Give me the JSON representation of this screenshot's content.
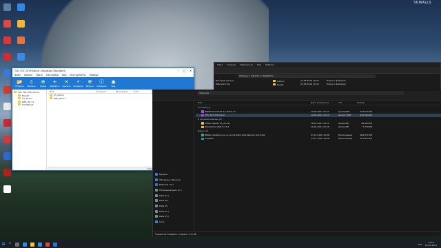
{
  "watermark": "SUWALLS",
  "desktop": {
    "icons_col1": [
      {
        "label": "",
        "color": "#5a7fa3",
        "icon": "recycle-bin-icon"
      },
      {
        "label": "",
        "color": "#e04a3a",
        "icon": "app-icon"
      },
      {
        "label": "",
        "color": "#e0342c",
        "icon": "app-icon"
      },
      {
        "label": "",
        "color": "#d62b2b",
        "icon": "app-icon"
      },
      {
        "label": "",
        "color": "#3a7bd5",
        "icon": "app-icon"
      },
      {
        "label": "",
        "color": "#d13b2e",
        "icon": "app-icon"
      },
      {
        "label": "",
        "color": "#e8e8e8",
        "icon": "app-icon"
      },
      {
        "label": "",
        "color": "#c92a2a",
        "icon": "app-icon"
      },
      {
        "label": "",
        "color": "#d93636",
        "icon": "app-icon"
      },
      {
        "label": "",
        "color": "#2a6bd1",
        "icon": "app-icon"
      },
      {
        "label": "",
        "color": "#b02020",
        "icon": "app-icon"
      },
      {
        "label": "",
        "color": "#ffffff",
        "icon": "app-icon"
      }
    ],
    "icons_col2": [
      {
        "label": "",
        "color": "#2e8ae6",
        "icon": "edge-icon"
      },
      {
        "label": "",
        "color": "#f2b632",
        "icon": "chrome-icon"
      },
      {
        "label": "",
        "color": "#e8743b",
        "icon": "app-icon"
      },
      {
        "label": "",
        "color": "#3d8be0",
        "icon": "app-icon"
      }
    ]
  },
  "bandizip": {
    "title": "TDL TGT 2019 Komp - Bandizip (Standard)",
    "menu": [
      "Файл",
      "Правка",
      "Поиск",
      "Настройки",
      "Вид",
      "Инструменты",
      "Помощь"
    ],
    "toolbar": [
      {
        "label": "Открыть",
        "icon": "open-icon",
        "glyph": "📂"
      },
      {
        "label": "Извлечь",
        "icon": "extract-icon",
        "glyph": "⇩"
      },
      {
        "label": "Новый",
        "icon": "new-icon",
        "glyph": "⊕"
      },
      {
        "label": "Добавить",
        "icon": "add-icon",
        "glyph": "+"
      },
      {
        "label": "Удалить",
        "icon": "delete-icon",
        "glyph": "✕"
      },
      {
        "label": "Проверка",
        "icon": "test-icon",
        "glyph": "⚡"
      },
      {
        "label": "Вирусы",
        "icon": "virus-icon",
        "glyph": "☢"
      },
      {
        "label": "Сведения",
        "icon": "info-icon",
        "glyph": "ⓘ"
      },
      {
        "label": "Вид",
        "icon": "view-icon",
        "glyph": "◉"
      }
    ],
    "tree": [
      "TDL TGT 2019 Komp",
      "Bandiz",
      "CS_addon",
      "RZD_IPA 11",
      "TimeMerak"
    ],
    "columns": [
      "Имя",
      "Сжатый",
      "Исходный",
      "Тип"
    ],
    "files": [
      "CS_addon",
      "RZD_IPA 11"
    ],
    "status": "Файл: 120, Папка: 2, Размер архива: 4,5 ГБ"
  },
  "explorer_back": {
    "tabs": [
      "Файл",
      "Главная",
      "Поделиться",
      "Вид",
      "Работа с"
    ],
    "path": "Фильмы > Data (E:) > RailWorks",
    "nav": [
      "Быстрый доступ",
      "Рабочий стол"
    ],
    "rows": [
      {
        "name": "Addons",
        "date": "10.05.2019 10:15",
        "type": "Папка с файлами"
      },
      {
        "name": "Assets",
        "date": "22.05.2019 10:16",
        "type": "Папка с файлами"
      }
    ]
  },
  "explorer": {
    "title": "Загрузки",
    "address": "Загрузки",
    "nav": [
      {
        "label": "Музыка",
        "color": "#2f80ed",
        "icon": "music-icon"
      },
      {
        "label": "Объемные объекты",
        "color": "#3b82c4",
        "icon": "3d-objects-icon"
      },
      {
        "label": "Рабочий стол",
        "color": "#3b6fc4",
        "icon": "desktop-icon"
      },
      {
        "label": "Локальный диск (C:)",
        "color": "#7a8a99",
        "icon": "drive-icon"
      },
      {
        "label": "Data (D:)",
        "color": "#7a8a99",
        "icon": "drive-icon"
      },
      {
        "label": "Data (E:)",
        "color": "#7a8a99",
        "icon": "drive-icon"
      },
      {
        "label": "Data (F:)",
        "color": "#7a8a99",
        "icon": "drive-icon"
      },
      {
        "label": "Data (G:)",
        "color": "#7a8a99",
        "icon": "drive-icon"
      },
      {
        "label": "Data (H:)",
        "color": "#7a8a99",
        "icon": "drive-icon"
      },
      {
        "label": "Сеть",
        "color": "#3b82c4",
        "icon": "network-icon"
      }
    ],
    "columns": [
      "Имя",
      "Дата изменения",
      "Тип",
      "Размер"
    ],
    "groups": [
      {
        "title": "Сегодня (2)",
        "rows": [
          {
            "name": "RW2019 Ind TGT 1 p 2019.rar",
            "date": "10.02.2021 15:11",
            "type": "Архив RAR",
            "size": "973 070 КБ",
            "color": "#b04ad4",
            "sel": false
          },
          {
            "name": "TDL TGT 2019 Kom",
            "date": "10.02.2021 15:14",
            "type": "Архив \"RAR\"",
            "size": "822 364 КБ",
            "color": "#b04ad4",
            "sel": true
          }
        ]
      },
      {
        "title": "В прошлом месяце (2)",
        "rows": [
          {
            "name": "DPlus Speedo t2_(r2.k1)",
            "date": "18.01.2021 10:11",
            "type": "Архив ZIP",
            "size": "99 963 КБ",
            "color": "#e0b84a",
            "sel": false
          },
          {
            "name": "NeuroDrive EML 8.12.4",
            "date": "19.01.2021 10:16",
            "type": "Архив ZIP",
            "size": "5 739 КБ",
            "color": "#e0b84a",
            "sel": false
          }
        ]
      },
      {
        "title": "Давно (2)",
        "rows": [
          {
            "name": "BBGTA desktop non-ui-non11.6dbk international dch-whql",
            "date": "07.12.2020 10:08",
            "type": "Приложение",
            "size": "608 870 КБ",
            "color": "#4aa84a",
            "sel": false
          },
          {
            "name": "wuj2kbd",
            "date": "27.11.2020 10:08",
            "type": "Приложение",
            "size": "307 823 КБ",
            "color": "#3b82c4",
            "sel": false
          }
        ]
      }
    ],
    "status": "Элементов: 6  Выбран 1 элемент: 813 МБ"
  },
  "taskbar": {
    "apps": [
      {
        "color": "#6a6f76",
        "icon": "task-view-icon"
      },
      {
        "color": "#2e8ae6",
        "icon": "edge-icon"
      },
      {
        "color": "#f2c232",
        "icon": "file-explorer-icon"
      },
      {
        "color": "#3d8be0",
        "icon": "store-icon"
      },
      {
        "color": "#e04a3a",
        "icon": "app-icon"
      },
      {
        "color": "#1f78d1",
        "icon": "bandizip-icon"
      }
    ],
    "lang": "РУС",
    "time": "13:52",
    "date": "10.02.2021"
  }
}
